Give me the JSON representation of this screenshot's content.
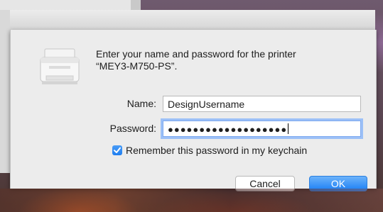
{
  "dialog": {
    "prompt_line1": "Enter your name and password for the printer",
    "prompt_line2": "“MEY3-M750-PS”.",
    "name_label": "Name:",
    "name_value": "DesignUsername",
    "password_label": "Password:",
    "password_mask": "●●●●●●●●●●●●●●●●●●●",
    "remember_label": "Remember this password in my keychain",
    "remember_checked": true,
    "cancel_label": "Cancel",
    "ok_label": "OK"
  },
  "icons": {
    "printer": "printer-icon",
    "checkbox": "checkmark-icon"
  },
  "colors": {
    "accent": "#1f7ef0",
    "focus_ring": "#9cc0f7",
    "sheet_bg": "#ececec"
  }
}
